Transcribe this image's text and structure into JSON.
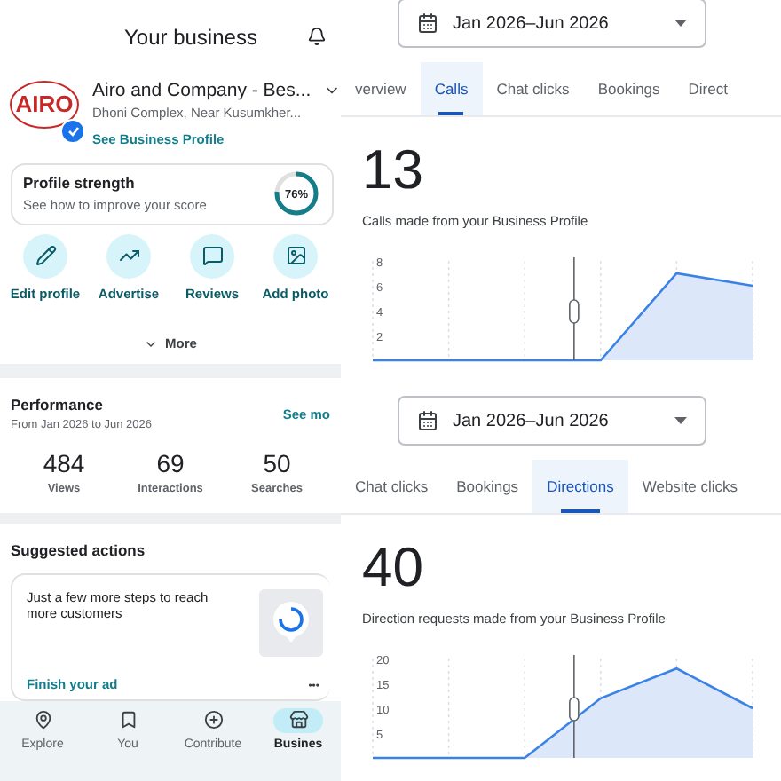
{
  "business": {
    "header": "Your business",
    "logo_text": "AIRO",
    "name": "Airo and Company - Bes...",
    "address": "Dhoni Complex, Near Kusumkher...",
    "verified": true,
    "profile_link": "See Business Profile",
    "strength": {
      "title": "Profile strength",
      "subtitle": "See how to improve your score",
      "reading": "76%"
    },
    "actions": [
      {
        "kind": "edit",
        "label": "Edit profile"
      },
      {
        "kind": "advertise",
        "label": "Advertise"
      },
      {
        "kind": "reviews",
        "label": "Reviews"
      },
      {
        "kind": "photo",
        "label": "Add photo"
      }
    ],
    "more": "More",
    "performance": {
      "title": "Performance",
      "subtitle": "From Jan 2026 to Jun 2026",
      "link": "See mo",
      "stats": [
        {
          "value": "484",
          "label": "Views"
        },
        {
          "value": "69",
          "label": "Interactions"
        },
        {
          "value": "50",
          "label": "Searches"
        }
      ]
    },
    "suggested": {
      "title": "Suggested actions",
      "text": "Just a few more steps to reach more customers",
      "action": "Finish your ad",
      "menu": "•••"
    },
    "nav": [
      {
        "kind": "explore",
        "label": "Explore",
        "selected": false
      },
      {
        "kind": "you",
        "label": "You",
        "selected": false
      },
      {
        "kind": "contribute",
        "label": "Contribute",
        "selected": false
      },
      {
        "kind": "business",
        "label": "Busines",
        "selected": true
      }
    ]
  },
  "panels": [
    {
      "date_range": "Jan 2026–Jun 2026",
      "tabs": [
        {
          "label": "verview",
          "selected": false
        },
        {
          "label": "Calls",
          "selected": true
        },
        {
          "label": "Chat clicks",
          "selected": false
        },
        {
          "label": "Bookings",
          "selected": false
        },
        {
          "label": "Direct",
          "selected": false
        }
      ],
      "total": "13",
      "caption": "Calls made from your Business Profile",
      "y_labels": [
        "8",
        "6",
        "4",
        "2"
      ]
    },
    {
      "date_range": "Jan 2026–Jun 2026",
      "tabs": [
        {
          "label": "Chat clicks",
          "selected": false
        },
        {
          "label": "Bookings",
          "selected": false
        },
        {
          "label": "Directions",
          "selected": true
        },
        {
          "label": "Website clicks",
          "selected": false
        }
      ],
      "total": "40",
      "caption": "Direction requests made from your Business Profile",
      "y_labels": [
        "20",
        "15",
        "10",
        "5"
      ]
    }
  ]
}
